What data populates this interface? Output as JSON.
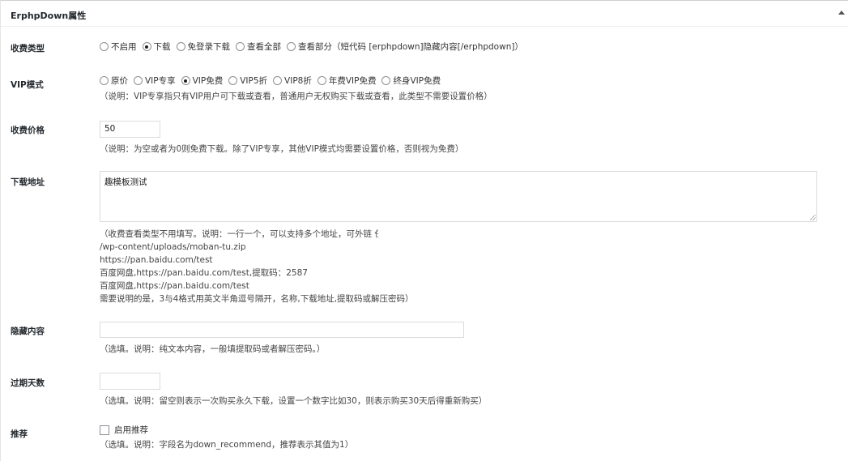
{
  "panel": {
    "title": "ErphpDown属性"
  },
  "fee_type": {
    "label": "收费类型",
    "options": [
      "不启用",
      "下载",
      "免登录下载",
      "查看全部",
      "查看部分（短代码 [erphpdown]隐藏内容[/erphpdown]）"
    ],
    "selected_index": 1
  },
  "vip_mode": {
    "label": "VIP模式",
    "options": [
      "原价",
      "VIP专享",
      "VIP免费",
      "VIP5折",
      "VIP8折",
      "年费VIP免费",
      "终身VIP免费"
    ],
    "selected_index": 2,
    "desc": "（说明：VIP专享指只有VIP用户可下载或查看，普通用户无权购买下载或查看，此类型不需要设置价格）"
  },
  "price": {
    "label": "收费价格",
    "value": "50",
    "desc": "（说明：为空或者为0则免费下载。除了VIP专享，其他VIP模式均需要设置价格，否则视为免费）"
  },
  "download_url": {
    "label": "下载地址",
    "value": "趣模板测试",
    "help_lines": [
      "（收费查看类型不用填写。说明：一行一个，可以支持多个地址，可外链                                    任意一种：",
      "/wp-content/uploads/moban-tu.zip",
      "https://pan.baidu.com/test",
      "百度网盘,https://pan.baidu.com/test,提取码：2587",
      "百度网盘,https://pan.baidu.com/test",
      "需要说明的是，3与4格式用英文半角逗号隔开，名称,下载地址,提取码或解压密码）"
    ]
  },
  "hidden_content": {
    "label": "隐藏内容",
    "value": "",
    "desc": "（选填。说明：纯文本内容，一般填提取码或者解压密码。）"
  },
  "expire_days": {
    "label": "过期天数",
    "value": "",
    "desc": "（选填。说明：留空则表示一次购买永久下载，设置一个数字比如30，则表示购买30天后得重新购买）"
  },
  "recommend": {
    "label": "推荐",
    "checkbox_label": "启用推荐",
    "checked": false,
    "desc": "（选填。说明：字段名为down_recommend，推荐表示其值为1）"
  }
}
